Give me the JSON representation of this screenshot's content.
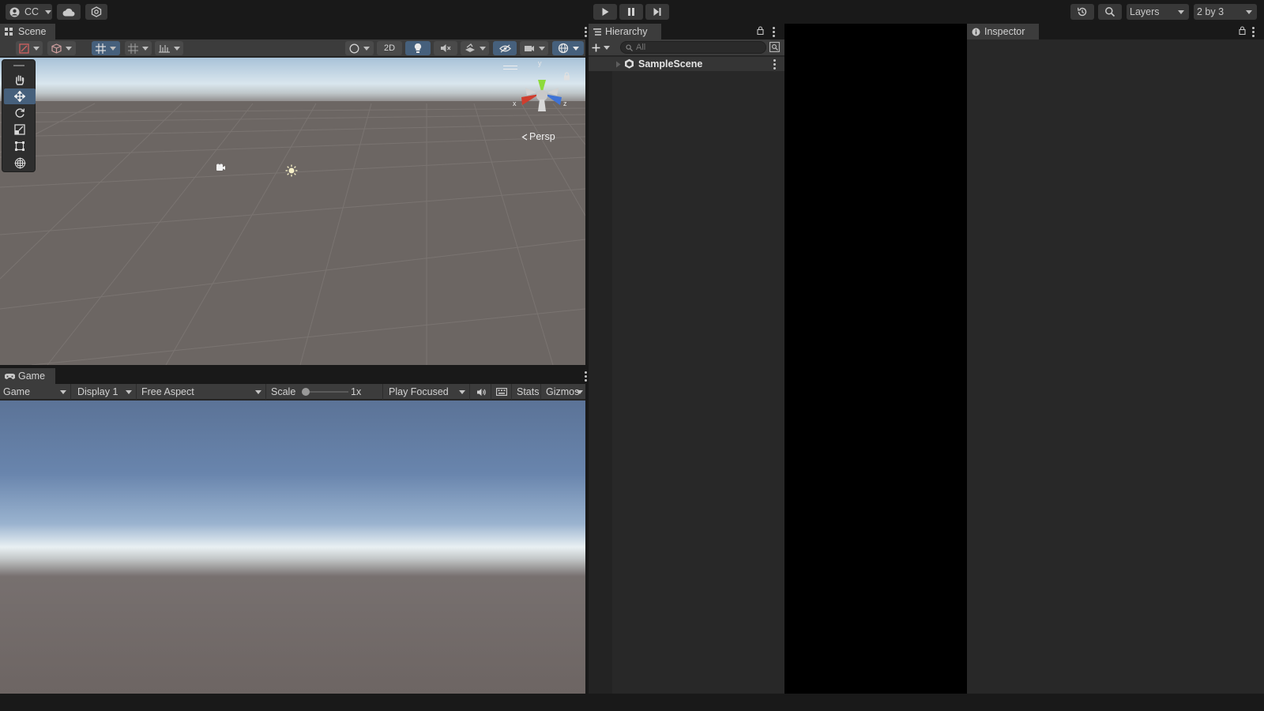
{
  "toolbar": {
    "account_label": "CC",
    "layers_label": "Layers",
    "layout_label": "2 by 3"
  },
  "scene": {
    "tab_label": "Scene",
    "btn_2d": "2D",
    "persp_label": "Persp",
    "gizmo_axes": {
      "x": "x",
      "y": "y",
      "z": "z"
    }
  },
  "game": {
    "tab_label": "Game",
    "view_select": "Game",
    "display_select": "Display 1",
    "aspect_select": "Free Aspect",
    "scale_label": "Scale",
    "scale_value": "1x",
    "play_mode": "Play Focused",
    "stats_label": "Stats",
    "gizmos_label": "Gizmos"
  },
  "hierarchy": {
    "tab_label": "Hierarchy",
    "search_placeholder": "All",
    "items": [
      {
        "label": "SampleScene"
      }
    ]
  },
  "inspector": {
    "tab_label": "Inspector"
  },
  "colors": {
    "accent_active": "#46607c",
    "panel_bg": "#282828",
    "tab_bg": "#3c3c3c",
    "chrome_bg": "#191919"
  }
}
